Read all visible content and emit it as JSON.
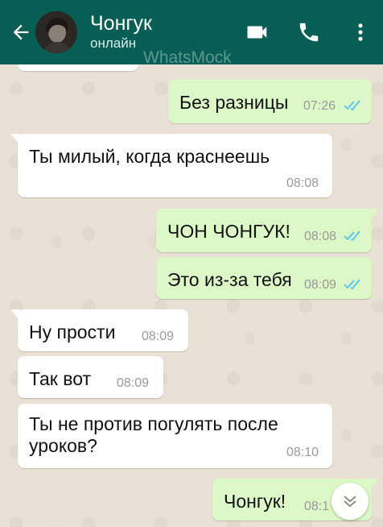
{
  "header": {
    "contact_name": "Чонгук",
    "status": "онлайн",
    "watermark": "WhatsMock",
    "icons": [
      "back-arrow-icon",
      "video-call-icon",
      "phone-icon",
      "more-vert-icon"
    ],
    "bg_color": "#075e54"
  },
  "messages": [
    {
      "direction": "out",
      "text": "Без разницы",
      "time": "07:26",
      "status": "read"
    },
    {
      "direction": "in",
      "text": "Ты милый, когда краснеешь",
      "time": "08:08"
    },
    {
      "direction": "out",
      "text": "ЧОН ЧОНГУК!",
      "time": "08:08",
      "status": "read"
    },
    {
      "direction": "out",
      "text": "Это из-за тебя",
      "time": "08:09",
      "status": "read"
    },
    {
      "direction": "in",
      "text": "Ну прости",
      "time": "08:09"
    },
    {
      "direction": "in",
      "text": "Так вот",
      "time": "08:09"
    },
    {
      "direction": "in",
      "text_line1": "Ты не против погулять после",
      "text_line2": "уроков?",
      "time": "08:10"
    },
    {
      "direction": "out",
      "text": "Чонгук!",
      "time": "08:1"
    }
  ],
  "colors": {
    "outgoing_bubble": "#dcf8c6",
    "incoming_bubble": "#ffffff",
    "read_ticks": "#4fc3f7"
  }
}
